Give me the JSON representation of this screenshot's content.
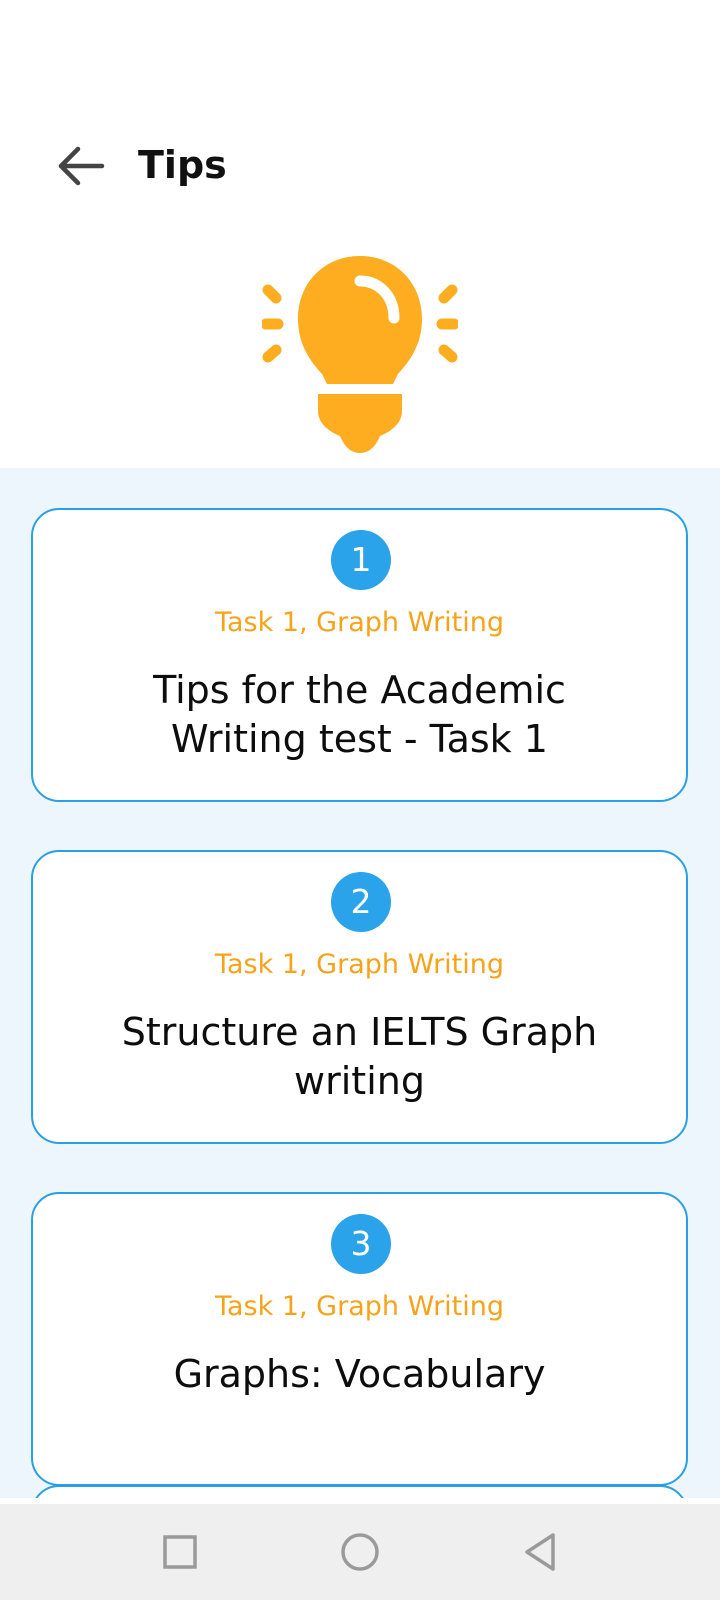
{
  "header": {
    "title": "Tips",
    "back_icon": "arrow-left-icon"
  },
  "hero": {
    "icon": "lightbulb-icon",
    "color": "#fdad1f"
  },
  "colors": {
    "accent": "#2aa3ea",
    "category": "#f6a31a",
    "list_background": "#eef6fd"
  },
  "tips": [
    {
      "number": "1",
      "category": "Task 1, Graph Writing",
      "title": "Tips for the Academic Writing test - Task 1"
    },
    {
      "number": "2",
      "category": "Task 1, Graph Writing",
      "title": "Structure an IELTS Graph writing"
    },
    {
      "number": "3",
      "category": "Task 1, Graph Writing",
      "title": "Graphs: Vocabulary"
    }
  ],
  "navigation": {
    "buttons": [
      "square-icon",
      "circle-icon",
      "triangle-back-icon"
    ]
  }
}
